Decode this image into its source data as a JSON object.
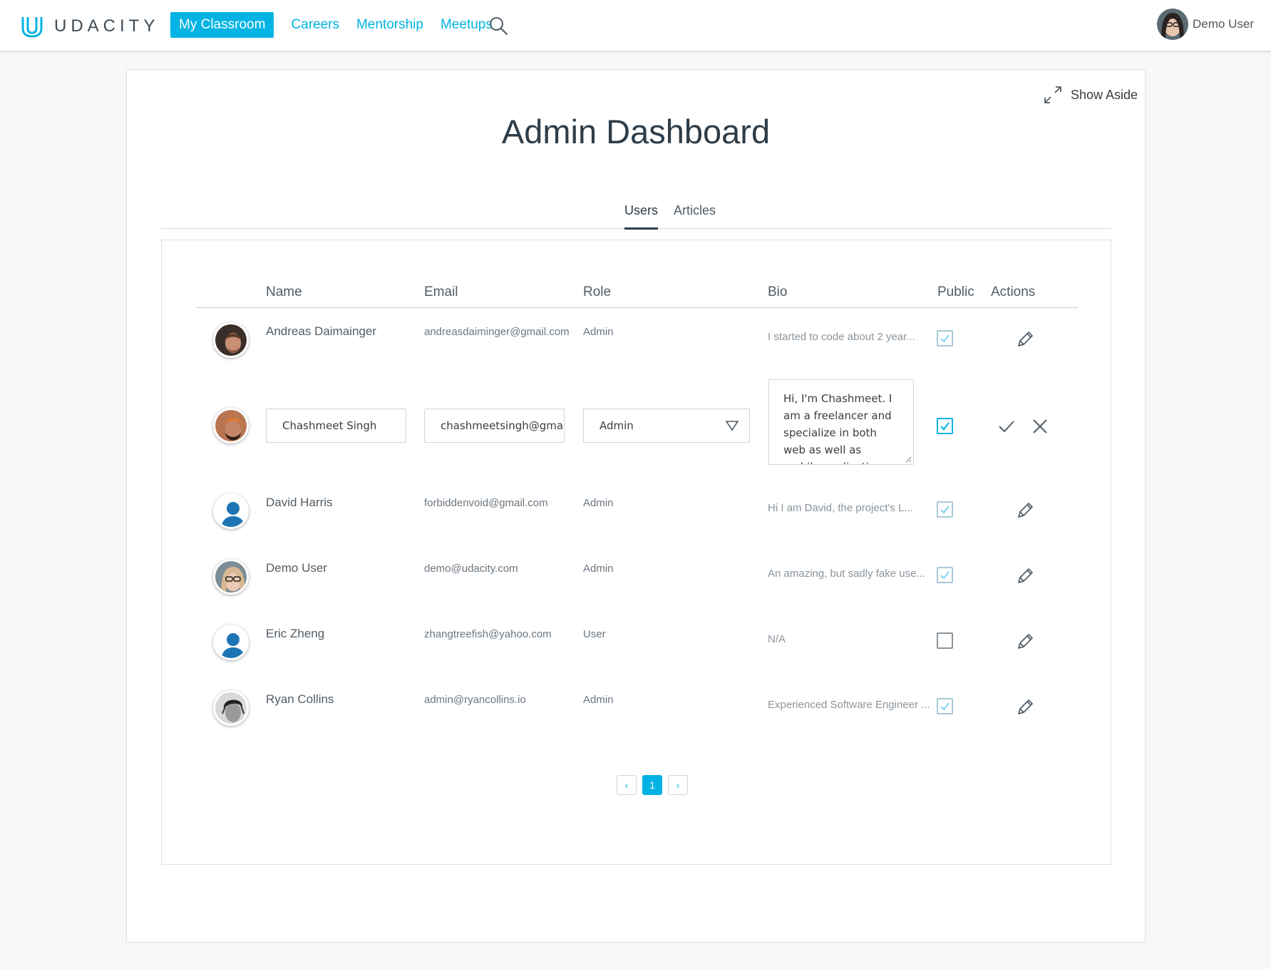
{
  "brand": {
    "name": "UDACITY",
    "color": "#02b3e4"
  },
  "nav": {
    "items": [
      {
        "label": "My Classroom",
        "active": true
      },
      {
        "label": "Careers"
      },
      {
        "label": "Mentorship"
      },
      {
        "label": "Meetups"
      }
    ],
    "search_icon": "search-icon"
  },
  "user": {
    "name": "Demo User"
  },
  "page": {
    "title": "Admin Dashboard",
    "show_aside": "Show Aside",
    "tabs": [
      {
        "label": "Users",
        "active": true
      },
      {
        "label": "Articles"
      }
    ]
  },
  "table": {
    "headers": {
      "name": "Name",
      "email": "Email",
      "role": "Role",
      "bio": "Bio",
      "public": "Public",
      "actions": "Actions"
    },
    "rows": [
      {
        "name": "Andreas Daimainger",
        "email": "andreasdaiminger@gmail.com",
        "role": "Admin",
        "bio": "I started to code about 2 year...",
        "public": true
      },
      {
        "name": "Chashmeet Singh",
        "email": "chashmeetsingh@gmail.com",
        "role": "Admin",
        "bio": "Hi, I'm Chashmeet. I am a freelancer and specialize in both web as well as mobile application",
        "public": true,
        "editing": true
      },
      {
        "name": "David Harris",
        "email": "forbiddenvoid@gmail.com",
        "role": "Admin",
        "bio": "Hi I am David, the project's L...",
        "public": true
      },
      {
        "name": "Demo User",
        "email": "demo@udacity.com",
        "role": "Admin",
        "bio": "An amazing, but sadly fake use...",
        "public": true
      },
      {
        "name": "Eric Zheng",
        "email": "zhangtreefish@yahoo.com",
        "role": "User",
        "bio": "N/A",
        "public": false
      },
      {
        "name": "Ryan Collins",
        "email": "admin@ryancollins.io",
        "role": "Admin",
        "bio": "Experienced Software Engineer ...",
        "public": true
      }
    ]
  },
  "pagination": {
    "prev": "‹",
    "current": "1",
    "next": "›"
  }
}
